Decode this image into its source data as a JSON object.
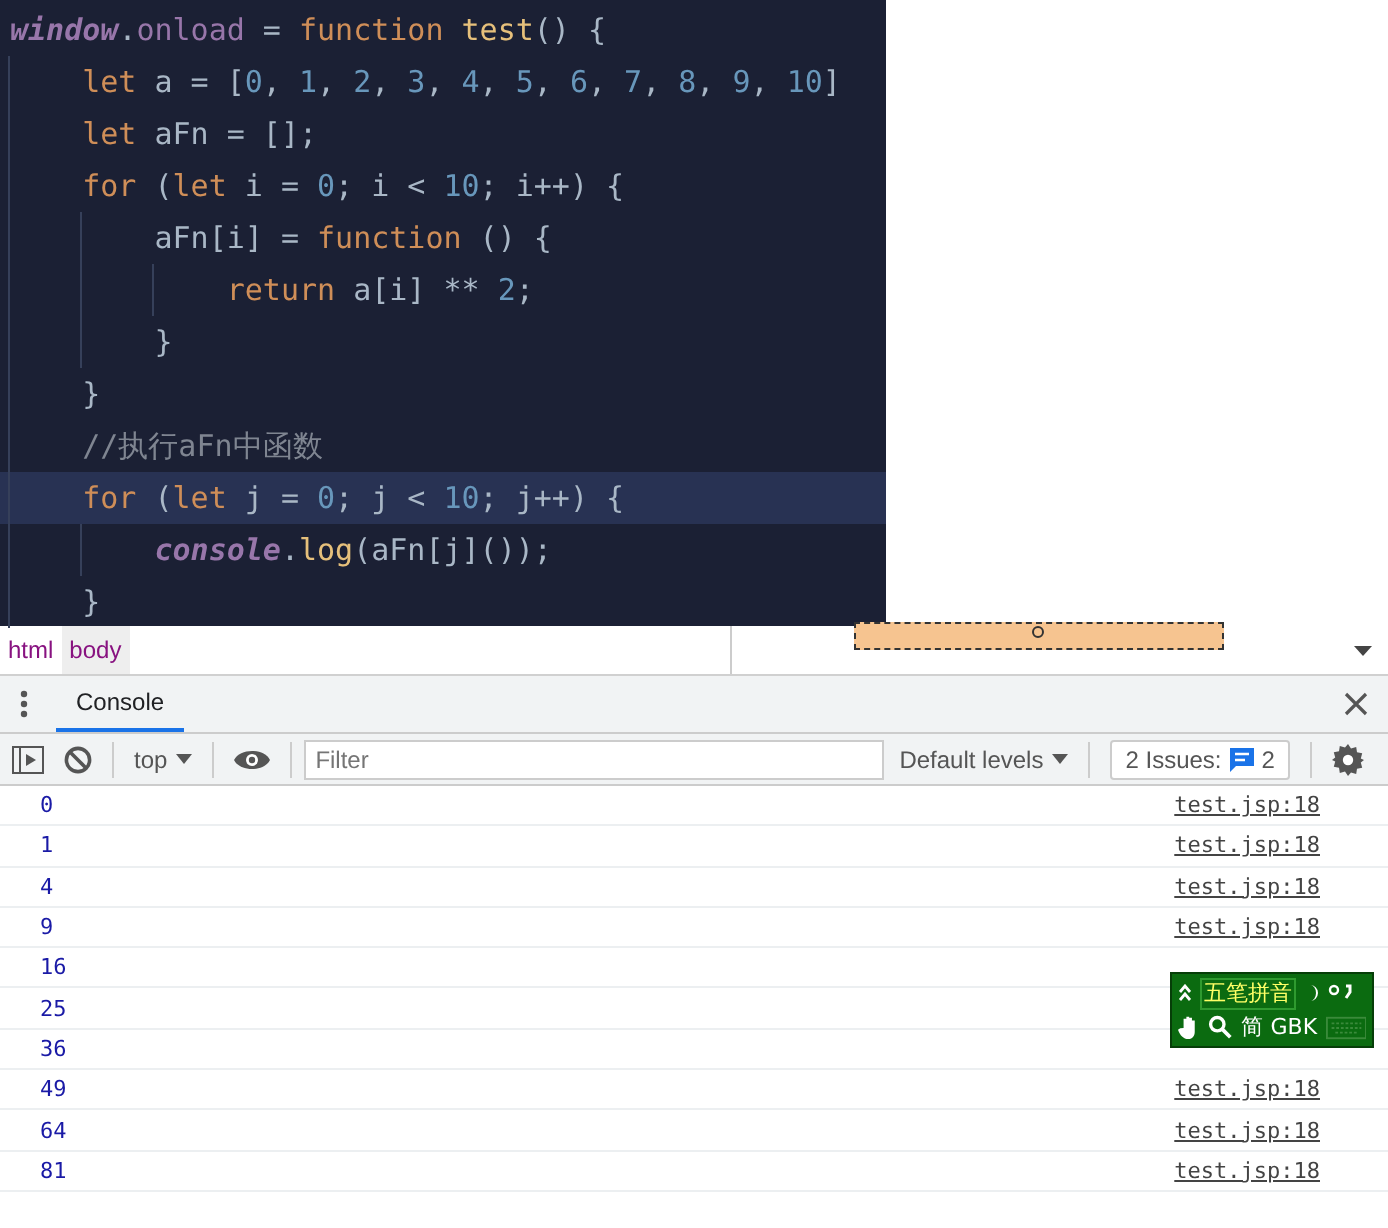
{
  "editor": {
    "lines": [
      {
        "current": false,
        "tokens": [
          {
            "t": "window",
            "kind": "global"
          },
          {
            "t": ".",
            "kind": "plain"
          },
          {
            "t": "onload",
            "kind": "prop"
          },
          {
            "t": " = ",
            "kind": "plain"
          },
          {
            "t": "function",
            "kind": "kw"
          },
          {
            "t": " test",
            "kind": "fn"
          },
          {
            "t": "() {",
            "kind": "plain"
          }
        ],
        "children": [
          {
            "current": false,
            "tokens": [
              {
                "t": "let",
                "kind": "kw"
              },
              {
                "t": " a = [",
                "kind": "plain"
              },
              {
                "t": "0",
                "kind": "num"
              },
              {
                "t": ", ",
                "kind": "plain"
              },
              {
                "t": "1",
                "kind": "num"
              },
              {
                "t": ", ",
                "kind": "plain"
              },
              {
                "t": "2",
                "kind": "num"
              },
              {
                "t": ", ",
                "kind": "plain"
              },
              {
                "t": "3",
                "kind": "num"
              },
              {
                "t": ", ",
                "kind": "plain"
              },
              {
                "t": "4",
                "kind": "num"
              },
              {
                "t": ", ",
                "kind": "plain"
              },
              {
                "t": "5",
                "kind": "num"
              },
              {
                "t": ", ",
                "kind": "plain"
              },
              {
                "t": "6",
                "kind": "num"
              },
              {
                "t": ", ",
                "kind": "plain"
              },
              {
                "t": "7",
                "kind": "num"
              },
              {
                "t": ", ",
                "kind": "plain"
              },
              {
                "t": "8",
                "kind": "num"
              },
              {
                "t": ", ",
                "kind": "plain"
              },
              {
                "t": "9",
                "kind": "num"
              },
              {
                "t": ", ",
                "kind": "plain"
              },
              {
                "t": "10",
                "kind": "num"
              },
              {
                "t": "]",
                "kind": "plain"
              }
            ]
          },
          {
            "current": false,
            "tokens": [
              {
                "t": "let",
                "kind": "kw"
              },
              {
                "t": " aFn = [];",
                "kind": "plain"
              }
            ]
          },
          {
            "current": false,
            "tokens": [
              {
                "t": "for",
                "kind": "kw"
              },
              {
                "t": " (",
                "kind": "plain"
              },
              {
                "t": "let",
                "kind": "kw"
              },
              {
                "t": " i = ",
                "kind": "plain"
              },
              {
                "t": "0",
                "kind": "num"
              },
              {
                "t": "; i < ",
                "kind": "plain"
              },
              {
                "t": "10",
                "kind": "num"
              },
              {
                "t": "; i++) {",
                "kind": "plain"
              }
            ],
            "children": [
              {
                "current": false,
                "tokens": [
                  {
                    "t": "aFn[i] = ",
                    "kind": "plain"
                  },
                  {
                    "t": "function",
                    "kind": "kw"
                  },
                  {
                    "t": " () {",
                    "kind": "plain"
                  }
                ],
                "children": [
                  {
                    "current": false,
                    "tokens": [
                      {
                        "t": "return",
                        "kind": "kw"
                      },
                      {
                        "t": " a[i] ** ",
                        "kind": "plain"
                      },
                      {
                        "t": "2",
                        "kind": "num"
                      },
                      {
                        "t": ";",
                        "kind": "plain"
                      }
                    ]
                  }
                ]
              },
              {
                "current": false,
                "tokens": [
                  {
                    "t": "}",
                    "kind": "plain"
                  }
                ]
              }
            ]
          },
          {
            "current": false,
            "tokens": [
              {
                "t": "}",
                "kind": "plain"
              }
            ]
          },
          {
            "current": false,
            "tokens": [
              {
                "t": "//执行aFn中函数",
                "kind": "comment"
              }
            ]
          },
          {
            "current": true,
            "tokens": [
              {
                "t": "for",
                "kind": "kw"
              },
              {
                "t": " (",
                "kind": "plain"
              },
              {
                "t": "let",
                "kind": "kw"
              },
              {
                "t": " j = ",
                "kind": "plain"
              },
              {
                "t": "0",
                "kind": "num"
              },
              {
                "t": "; j < ",
                "kind": "plain"
              },
              {
                "t": "10",
                "kind": "num"
              },
              {
                "t": "; j++) {",
                "kind": "plain"
              }
            ],
            "children": [
              {
                "current": false,
                "tokens": [
                  {
                    "t": "console",
                    "kind": "global"
                  },
                  {
                    "t": ".",
                    "kind": "plain"
                  },
                  {
                    "t": "log",
                    "kind": "fn"
                  },
                  {
                    "t": "(aFn[j]());",
                    "kind": "plain"
                  }
                ]
              }
            ]
          },
          {
            "current": false,
            "tokens": [
              {
                "t": "}",
                "kind": "plain"
              }
            ]
          }
        ]
      }
    ]
  },
  "elements_bar": {
    "breadcrumbs": [
      {
        "label": "html",
        "selected": false
      },
      {
        "label": "body",
        "selected": true
      }
    ]
  },
  "drawer": {
    "tabs": [
      {
        "label": "Console",
        "selected": true
      }
    ]
  },
  "toolbar": {
    "context": "top",
    "filter": {
      "placeholder": "Filter"
    },
    "levels": "Default levels",
    "issues": {
      "label": "2 Issues:",
      "count": "2"
    }
  },
  "console": {
    "rows": [
      {
        "value": "0",
        "source": "test.jsp:18"
      },
      {
        "value": "1",
        "source": "test.jsp:18"
      },
      {
        "value": "4",
        "source": "test.jsp:18"
      },
      {
        "value": "9",
        "source": "test.jsp:18"
      },
      {
        "value": "16"
      },
      {
        "value": "25"
      },
      {
        "value": "36"
      },
      {
        "value": "49",
        "source": "test.jsp:18"
      },
      {
        "value": "64",
        "source": "test.jsp:18"
      },
      {
        "value": "81",
        "source": "test.jsp:18"
      }
    ]
  },
  "ime_bar": {
    "mode": "五笔拼音",
    "script": "简",
    "encoding": "GBK"
  }
}
